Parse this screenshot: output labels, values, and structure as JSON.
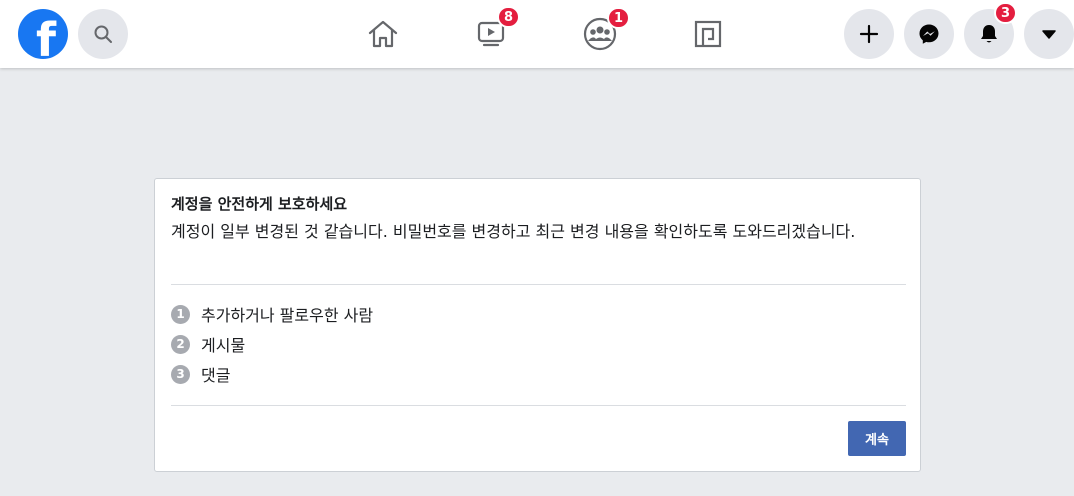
{
  "header": {
    "logo_letter": "f",
    "nav": {
      "watch_badge": "8",
      "groups_badge": "1"
    },
    "right": {
      "notifications_badge": "3"
    }
  },
  "card": {
    "title": "계정을 안전하게 보호하세요",
    "description": "계정이 일부 변경된 것 같습니다. 비밀번호를 변경하고 최근 변경 내용을 확인하도록 도와드리겠습니다.",
    "items": [
      {
        "num": "1",
        "label": "추가하거나 팔로우한 사람"
      },
      {
        "num": "2",
        "label": "게시물"
      },
      {
        "num": "3",
        "label": "댓글"
      }
    ],
    "continue_label": "계속"
  },
  "colors": {
    "brand": "#1877f2",
    "badge": "#e41e3f",
    "button": "#4267b2",
    "background": "#e9ebee"
  }
}
